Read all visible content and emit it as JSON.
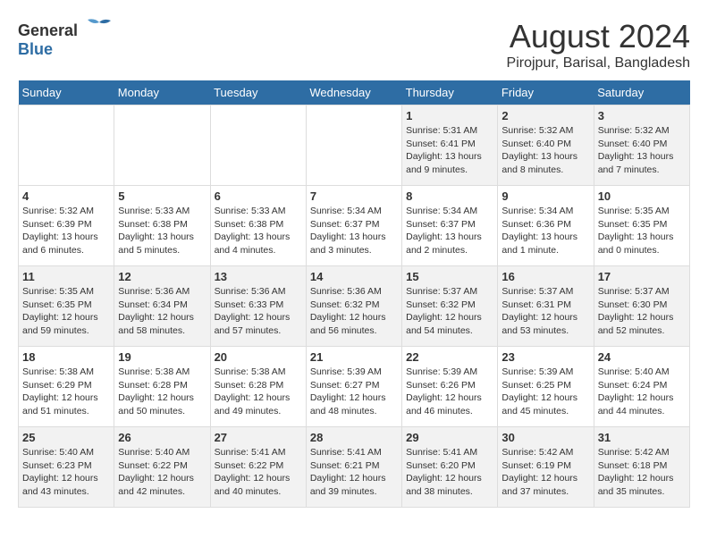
{
  "header": {
    "logo_general": "General",
    "logo_blue": "Blue",
    "month_title": "August 2024",
    "location": "Pirojpur, Barisal, Bangladesh"
  },
  "days_of_week": [
    "Sunday",
    "Monday",
    "Tuesday",
    "Wednesday",
    "Thursday",
    "Friday",
    "Saturday"
  ],
  "weeks": [
    [
      {
        "day": "",
        "content": ""
      },
      {
        "day": "",
        "content": ""
      },
      {
        "day": "",
        "content": ""
      },
      {
        "day": "",
        "content": ""
      },
      {
        "day": "1",
        "content": "Sunrise: 5:31 AM\nSunset: 6:41 PM\nDaylight: 13 hours\nand 9 minutes."
      },
      {
        "day": "2",
        "content": "Sunrise: 5:32 AM\nSunset: 6:40 PM\nDaylight: 13 hours\nand 8 minutes."
      },
      {
        "day": "3",
        "content": "Sunrise: 5:32 AM\nSunset: 6:40 PM\nDaylight: 13 hours\nand 7 minutes."
      }
    ],
    [
      {
        "day": "4",
        "content": "Sunrise: 5:32 AM\nSunset: 6:39 PM\nDaylight: 13 hours\nand 6 minutes."
      },
      {
        "day": "5",
        "content": "Sunrise: 5:33 AM\nSunset: 6:38 PM\nDaylight: 13 hours\nand 5 minutes."
      },
      {
        "day": "6",
        "content": "Sunrise: 5:33 AM\nSunset: 6:38 PM\nDaylight: 13 hours\nand 4 minutes."
      },
      {
        "day": "7",
        "content": "Sunrise: 5:34 AM\nSunset: 6:37 PM\nDaylight: 13 hours\nand 3 minutes."
      },
      {
        "day": "8",
        "content": "Sunrise: 5:34 AM\nSunset: 6:37 PM\nDaylight: 13 hours\nand 2 minutes."
      },
      {
        "day": "9",
        "content": "Sunrise: 5:34 AM\nSunset: 6:36 PM\nDaylight: 13 hours\nand 1 minute."
      },
      {
        "day": "10",
        "content": "Sunrise: 5:35 AM\nSunset: 6:35 PM\nDaylight: 13 hours\nand 0 minutes."
      }
    ],
    [
      {
        "day": "11",
        "content": "Sunrise: 5:35 AM\nSunset: 6:35 PM\nDaylight: 12 hours\nand 59 minutes."
      },
      {
        "day": "12",
        "content": "Sunrise: 5:36 AM\nSunset: 6:34 PM\nDaylight: 12 hours\nand 58 minutes."
      },
      {
        "day": "13",
        "content": "Sunrise: 5:36 AM\nSunset: 6:33 PM\nDaylight: 12 hours\nand 57 minutes."
      },
      {
        "day": "14",
        "content": "Sunrise: 5:36 AM\nSunset: 6:32 PM\nDaylight: 12 hours\nand 56 minutes."
      },
      {
        "day": "15",
        "content": "Sunrise: 5:37 AM\nSunset: 6:32 PM\nDaylight: 12 hours\nand 54 minutes."
      },
      {
        "day": "16",
        "content": "Sunrise: 5:37 AM\nSunset: 6:31 PM\nDaylight: 12 hours\nand 53 minutes."
      },
      {
        "day": "17",
        "content": "Sunrise: 5:37 AM\nSunset: 6:30 PM\nDaylight: 12 hours\nand 52 minutes."
      }
    ],
    [
      {
        "day": "18",
        "content": "Sunrise: 5:38 AM\nSunset: 6:29 PM\nDaylight: 12 hours\nand 51 minutes."
      },
      {
        "day": "19",
        "content": "Sunrise: 5:38 AM\nSunset: 6:28 PM\nDaylight: 12 hours\nand 50 minutes."
      },
      {
        "day": "20",
        "content": "Sunrise: 5:38 AM\nSunset: 6:28 PM\nDaylight: 12 hours\nand 49 minutes."
      },
      {
        "day": "21",
        "content": "Sunrise: 5:39 AM\nSunset: 6:27 PM\nDaylight: 12 hours\nand 48 minutes."
      },
      {
        "day": "22",
        "content": "Sunrise: 5:39 AM\nSunset: 6:26 PM\nDaylight: 12 hours\nand 46 minutes."
      },
      {
        "day": "23",
        "content": "Sunrise: 5:39 AM\nSunset: 6:25 PM\nDaylight: 12 hours\nand 45 minutes."
      },
      {
        "day": "24",
        "content": "Sunrise: 5:40 AM\nSunset: 6:24 PM\nDaylight: 12 hours\nand 44 minutes."
      }
    ],
    [
      {
        "day": "25",
        "content": "Sunrise: 5:40 AM\nSunset: 6:23 PM\nDaylight: 12 hours\nand 43 minutes."
      },
      {
        "day": "26",
        "content": "Sunrise: 5:40 AM\nSunset: 6:22 PM\nDaylight: 12 hours\nand 42 minutes."
      },
      {
        "day": "27",
        "content": "Sunrise: 5:41 AM\nSunset: 6:22 PM\nDaylight: 12 hours\nand 40 minutes."
      },
      {
        "day": "28",
        "content": "Sunrise: 5:41 AM\nSunset: 6:21 PM\nDaylight: 12 hours\nand 39 minutes."
      },
      {
        "day": "29",
        "content": "Sunrise: 5:41 AM\nSunset: 6:20 PM\nDaylight: 12 hours\nand 38 minutes."
      },
      {
        "day": "30",
        "content": "Sunrise: 5:42 AM\nSunset: 6:19 PM\nDaylight: 12 hours\nand 37 minutes."
      },
      {
        "day": "31",
        "content": "Sunrise: 5:42 AM\nSunset: 6:18 PM\nDaylight: 12 hours\nand 35 minutes."
      }
    ]
  ]
}
